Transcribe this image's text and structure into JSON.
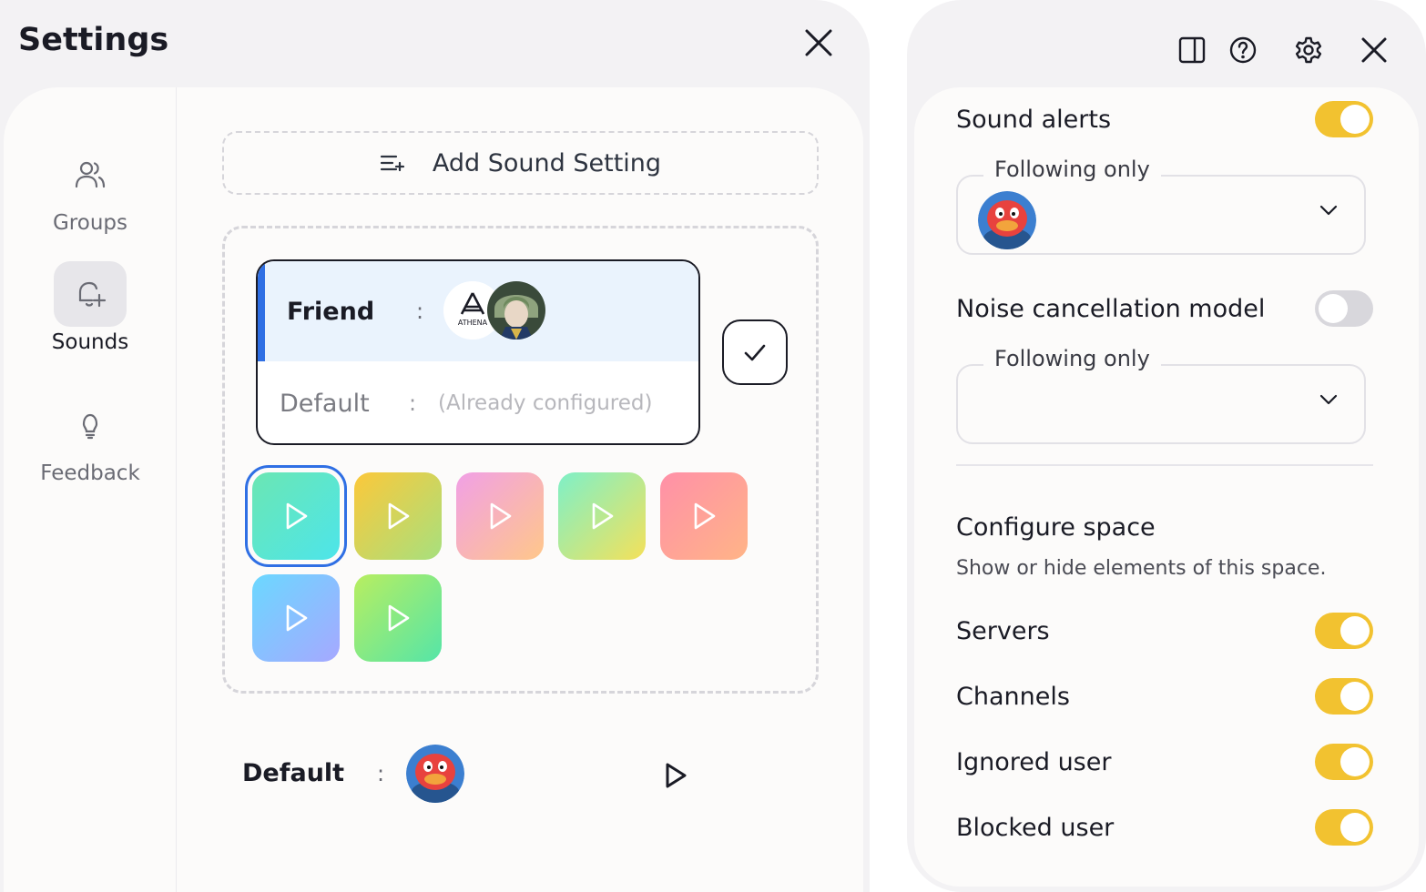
{
  "settings": {
    "title": "Settings",
    "nav": [
      {
        "label": "Groups",
        "icon": "users-icon",
        "active": false
      },
      {
        "label": "Sounds",
        "icon": "bell-plus-icon",
        "active": true
      },
      {
        "label": "Feedback",
        "icon": "lightbulb-icon",
        "active": false
      }
    ],
    "add_sound_label": "Add Sound Setting",
    "friend_row": {
      "label": "Friend",
      "colon": ":"
    },
    "default_row": {
      "label": "Default",
      "colon": ":",
      "value": "(Already configured)"
    },
    "athena_logo_text": "ATHENA",
    "sound_tiles": [
      {
        "from": "#6be6b3",
        "to": "#4de5ea",
        "selected": true
      },
      {
        "from": "#fcc83a",
        "to": "#a7e07e",
        "selected": false
      },
      {
        "from": "#f1a0e6",
        "to": "#ffc78a",
        "selected": false
      },
      {
        "from": "#7ef0c8",
        "to": "#f4e15a",
        "selected": false
      },
      {
        "from": "#ff90a8",
        "to": "#ffb487",
        "selected": false
      },
      {
        "from": "#6bd8ff",
        "to": "#a6a8ff",
        "selected": false
      },
      {
        "from": "#b8ee60",
        "to": "#55e5a8",
        "selected": false
      }
    ],
    "default_line": {
      "label": "Default",
      "colon": ":"
    }
  },
  "right_panel": {
    "sound_alerts": {
      "label": "Sound alerts",
      "on": true
    },
    "sound_alerts_select": {
      "legend": "Following only"
    },
    "noise_cancellation": {
      "label": "Noise cancellation model",
      "on": false
    },
    "noise_select": {
      "legend": "Following only"
    },
    "configure": {
      "title": "Configure space",
      "subtitle": "Show or hide elements of this space."
    },
    "toggles": [
      {
        "label": "Servers",
        "on": true
      },
      {
        "label": "Channels",
        "on": true
      },
      {
        "label": "Ignored user",
        "on": true
      },
      {
        "label": "Blocked user",
        "on": true
      }
    ]
  },
  "colors": {
    "accent_blue": "#2f6fe4",
    "toggle_on": "#f2c230",
    "toggle_off": "#d8d7dc"
  }
}
